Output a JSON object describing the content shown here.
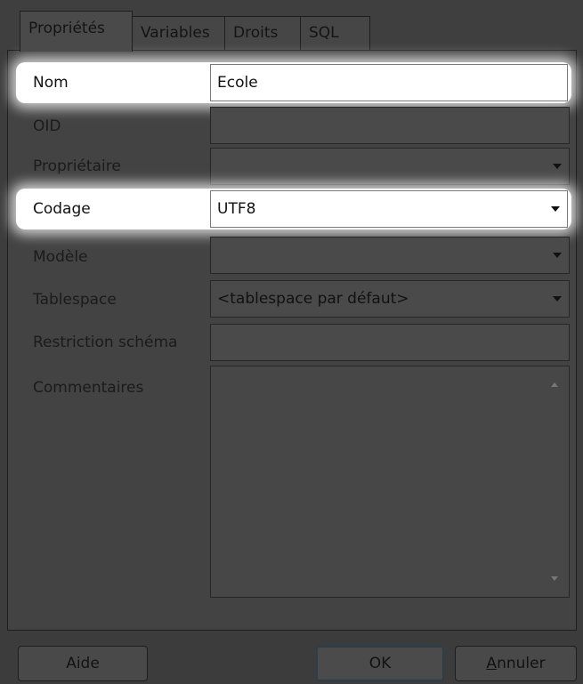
{
  "tabs": [
    {
      "label": "Propriétés",
      "active": true
    },
    {
      "label": "Variables",
      "active": false
    },
    {
      "label": "Droits",
      "active": false
    },
    {
      "label": "SQL",
      "active": false
    }
  ],
  "form": {
    "nom": {
      "label": "Nom",
      "value": "Ecole"
    },
    "oid": {
      "label": "OID",
      "value": ""
    },
    "proprietaire": {
      "label": "Propriétaire",
      "value": ""
    },
    "codage": {
      "label": "Codage",
      "value": "UTF8"
    },
    "modele": {
      "label": "Modèle",
      "value": ""
    },
    "tablespace": {
      "label": "Tablespace",
      "value": "<tablespace par défaut>"
    },
    "restriction": {
      "label": "Restriction schéma",
      "value": ""
    },
    "commentaires": {
      "label": "Commentaires",
      "value": ""
    }
  },
  "buttons": {
    "aide": "Aide",
    "ok": "OK",
    "annuler": "Annuler"
  },
  "highlight_color": "#ffffff"
}
